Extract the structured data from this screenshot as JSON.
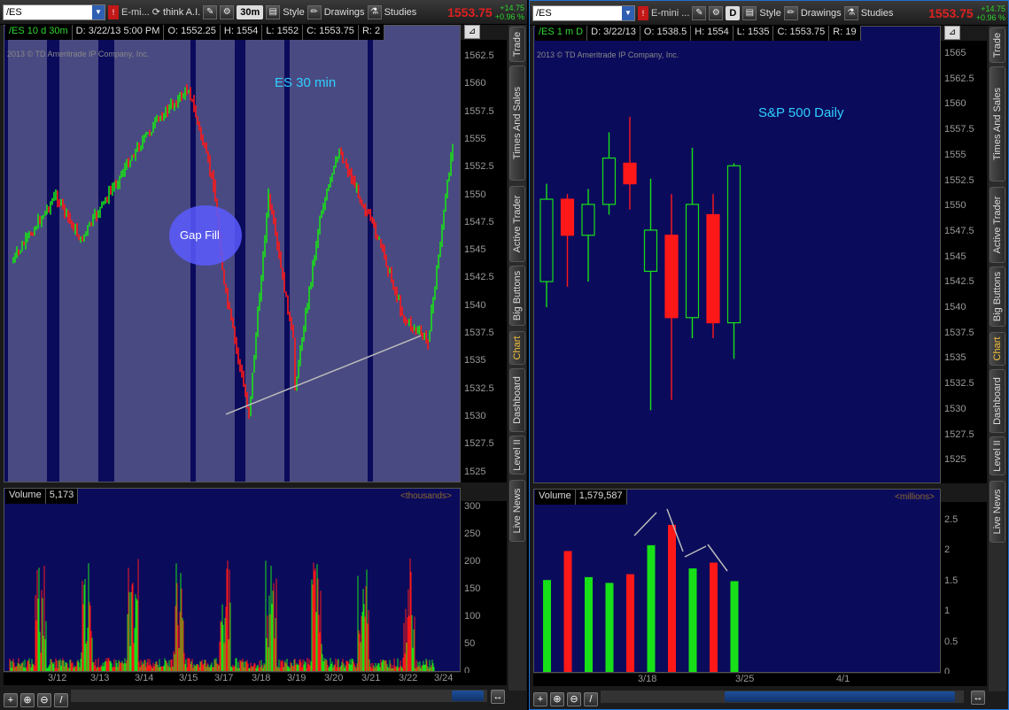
{
  "left_window": {
    "symbol": "/ES",
    "instrument_name": "E-mi...",
    "think_label": "think A.I.",
    "timeframe": "30m",
    "style_label": "Style",
    "drawings_label": "Drawings",
    "studies_label": "Studies",
    "last_price": "1553.75",
    "net_change": "+14.75",
    "pct_change": "+0.96 %",
    "info": {
      "desc": "/ES 10 d 30m",
      "date": "D: 3/22/13 5:00 PM",
      "open": "O: 1552.25",
      "high": "H: 1554",
      "low": "L: 1552",
      "close": "C: 1553.75",
      "range": "R: 2"
    },
    "copyright": "2013 © TD Ameritrade IP Company, Inc.",
    "chart_title": "ES 30 min",
    "annotation": "Gap Fill",
    "price_axis": [
      "1562.5",
      "1560",
      "1557.5",
      "1555",
      "1552.5",
      "1550",
      "1547.5",
      "1545",
      "1542.5",
      "1540",
      "1537.5",
      "1535",
      "1532.5",
      "1530",
      "1527.5",
      "1525"
    ],
    "volume_label": "Volume",
    "volume_value": "5,173",
    "volume_unit": "<thousands>",
    "volume_axis": [
      "300",
      "250",
      "200",
      "150",
      "100",
      "50",
      "0"
    ],
    "x_axis": [
      "3/12",
      "3/13",
      "3/14",
      "3/15",
      "3/17",
      "3/18",
      "3/19",
      "3/20",
      "3/21",
      "3/22",
      "3/24"
    ]
  },
  "right_window": {
    "symbol": "/ES",
    "instrument_name": "E-mini ...",
    "timeframe": "D",
    "style_label": "Style",
    "drawings_label": "Drawings",
    "studies_label": "Studies",
    "last_price": "1553.75",
    "net_change": "+14.75",
    "pct_change": "+0.96 %",
    "info": {
      "desc": "/ES 1 m D",
      "date": "D: 3/22/13",
      "open": "O: 1538.5",
      "high": "H: 1554",
      "low": "L: 1535",
      "close": "C: 1553.75",
      "range": "R: 19"
    },
    "copyright": "2013 © TD Ameritrade IP Company, Inc.",
    "chart_title": "S&P 500 Daily",
    "price_axis": [
      "1565",
      "1562.5",
      "1560",
      "1557.5",
      "1555",
      "1552.5",
      "1550",
      "1547.5",
      "1545",
      "1542.5",
      "1540",
      "1537.5",
      "1535",
      "1532.5",
      "1530",
      "1527.5",
      "1525"
    ],
    "volume_label": "Volume",
    "volume_value": "1,579,587",
    "volume_unit": "<millions>",
    "volume_axis": [
      "2.5",
      "2",
      "1.5",
      "1",
      "0.5",
      "0"
    ],
    "x_axis": [
      "3/18",
      "3/25",
      "4/1"
    ]
  },
  "side_tabs": [
    "Trade",
    "Times And Sales",
    "Active Trader",
    "Big Buttons",
    "Chart",
    "Dashboard",
    "Level II",
    "Live News"
  ],
  "active_tab": "Chart",
  "colors": {
    "chart_bg": "#0b0b5c",
    "session_stripe": "#4a4a82",
    "up": "#18e018",
    "down": "#ff1818",
    "title": "#2fd0ff"
  },
  "chart_data": [
    {
      "type": "candlestick",
      "chart": "ES 30 min intraday (approximate path)",
      "price_range": [
        1523.5,
        1563.5
      ],
      "path_points": [
        {
          "x": "3/12",
          "price": 1543
        },
        {
          "x": "3/13",
          "price": 1549
        },
        {
          "x": "3/13",
          "price": 1545
        },
        {
          "x": "3/14",
          "price": 1553
        },
        {
          "x": "3/14",
          "price": 1556
        },
        {
          "x": "3/15",
          "price": 1558.5
        },
        {
          "x": "3/15",
          "price": 1550
        },
        {
          "x": "3/17",
          "price": 1541
        },
        {
          "x": "3/17",
          "price": 1529.5
        },
        {
          "x": "3/18",
          "price": 1549
        },
        {
          "x": "3/18",
          "price": 1536
        },
        {
          "x": "3/19",
          "price": 1532
        },
        {
          "x": "3/19",
          "price": 1547
        },
        {
          "x": "3/20",
          "price": 1553
        },
        {
          "x": "3/21",
          "price": 1545
        },
        {
          "x": "3/21",
          "price": 1538
        },
        {
          "x": "3/22",
          "price": 1536
        },
        {
          "x": "3/22",
          "price": 1553.75
        }
      ],
      "trendline": [
        {
          "x": "3/17",
          "price": 1529.5
        },
        {
          "x": "3/22",
          "price": 1536.5
        }
      ]
    },
    {
      "type": "candlestick",
      "chart": "S&P 500 Daily",
      "price_range": [
        1523.5,
        1566.5
      ],
      "candles": [
        {
          "open": 1542.5,
          "close": 1550.5,
          "high": 1552,
          "low": 1540,
          "dir": "up"
        },
        {
          "open": 1550.5,
          "close": 1547,
          "high": 1551,
          "low": 1542,
          "dir": "down"
        },
        {
          "open": 1547,
          "close": 1550,
          "high": 1551.5,
          "low": 1542.5,
          "dir": "up"
        },
        {
          "open": 1550,
          "close": 1554.5,
          "high": 1557,
          "low": 1549,
          "dir": "up"
        },
        {
          "open": 1554,
          "close": 1552,
          "high": 1558.5,
          "low": 1549.5,
          "dir": "down"
        },
        {
          "open": 1543.5,
          "close": 1547.5,
          "high": 1552.5,
          "low": 1530,
          "dir": "up"
        },
        {
          "open": 1547,
          "close": 1539,
          "high": 1551,
          "low": 1531,
          "dir": "down"
        },
        {
          "open": 1539,
          "close": 1550,
          "high": 1555.5,
          "low": 1537,
          "dir": "up"
        },
        {
          "open": 1549,
          "close": 1538.5,
          "high": 1551,
          "low": 1537,
          "dir": "down"
        },
        {
          "open": 1538.5,
          "close": 1553.75,
          "high": 1554,
          "low": 1535,
          "dir": "up"
        }
      ],
      "volume_millions": [
        1.6,
        2.1,
        1.65,
        1.55,
        1.7,
        2.2,
        2.55,
        1.8,
        1.9,
        1.58
      ]
    }
  ]
}
